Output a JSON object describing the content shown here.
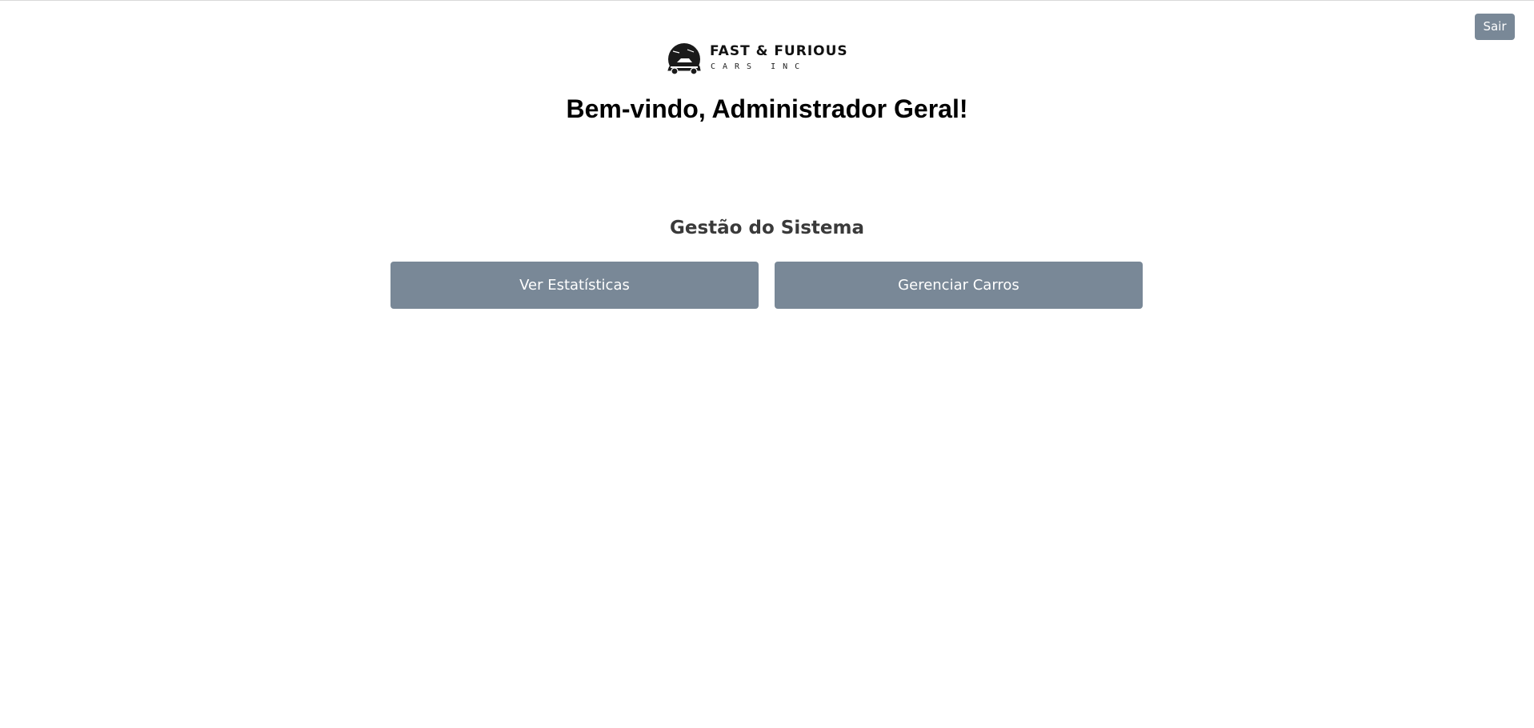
{
  "header": {
    "logout_label": "Sair"
  },
  "brand": {
    "name": "FAST & FURIOUS",
    "tagline": "CARS INC"
  },
  "welcome": {
    "title": "Bem-vindo, Administrador Geral!"
  },
  "management": {
    "title": "Gestão do Sistema",
    "actions": [
      {
        "label": "Ver Estatísticas"
      },
      {
        "label": "Gerenciar Carros"
      }
    ]
  },
  "colors": {
    "button_bg": "#798897",
    "button_text": "#ffffff",
    "heading": "#000000",
    "section_heading": "#3a3a3a"
  }
}
